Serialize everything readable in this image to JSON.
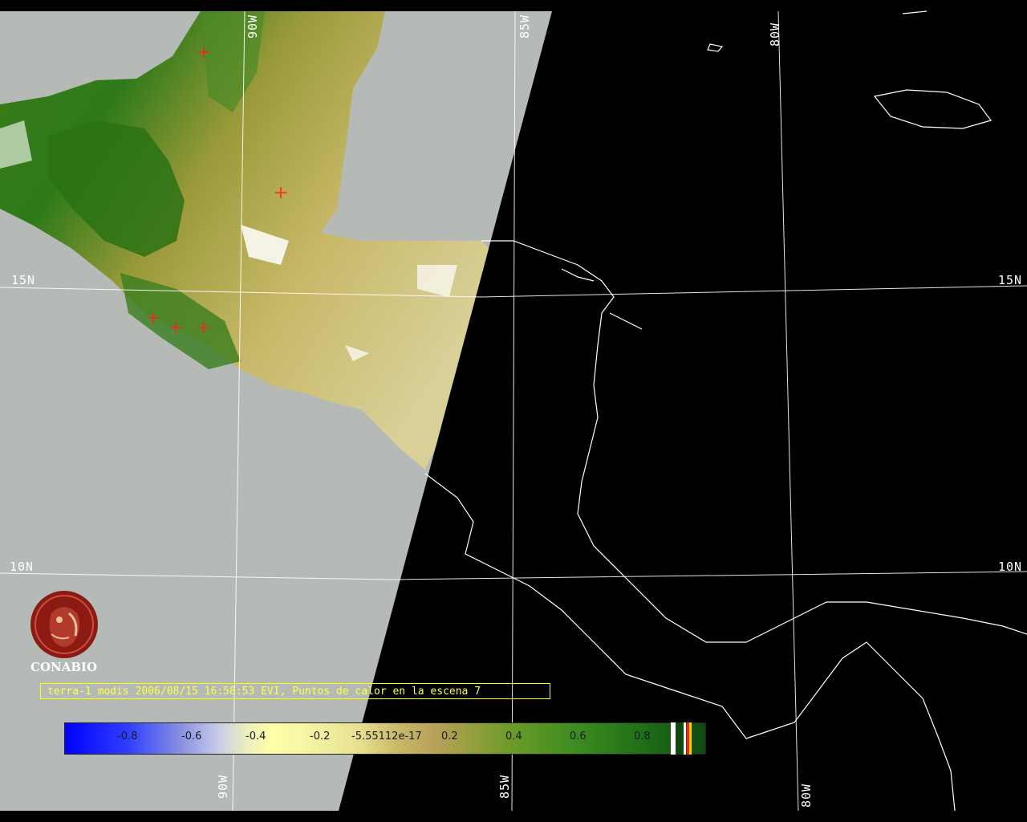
{
  "grid_labels": {
    "lat_left": [
      "15N",
      "10N"
    ],
    "lat_right": [
      "15N",
      "10N"
    ],
    "lon_top": [
      "90W",
      "85W",
      "80W"
    ],
    "lon_bottom": [
      "90W",
      "85W",
      "80W"
    ]
  },
  "logo": {
    "text": "CONABIO",
    "icon": "conabio-macaw-logo-icon"
  },
  "caption": "terra-1 modis 2006/08/15 16:58:53 EVI, Puntos de calor en la escena 7",
  "colorbar": {
    "ticks": [
      "-0.8",
      "-0.6",
      "-0.4",
      "-0.2",
      "-5.55112e-17",
      "0.2",
      "0.4",
      "0.6",
      "0.8"
    ]
  },
  "colors": {
    "no_data_swath": "#b5bab7",
    "night_background": "#000000",
    "coastline": "#ffffff",
    "graticule": "#ffffff",
    "hotspot_marker": "#ff2020",
    "caption_border": "#ffff00",
    "logo": "#8b1a12"
  },
  "hotspots_count_shown": 5
}
